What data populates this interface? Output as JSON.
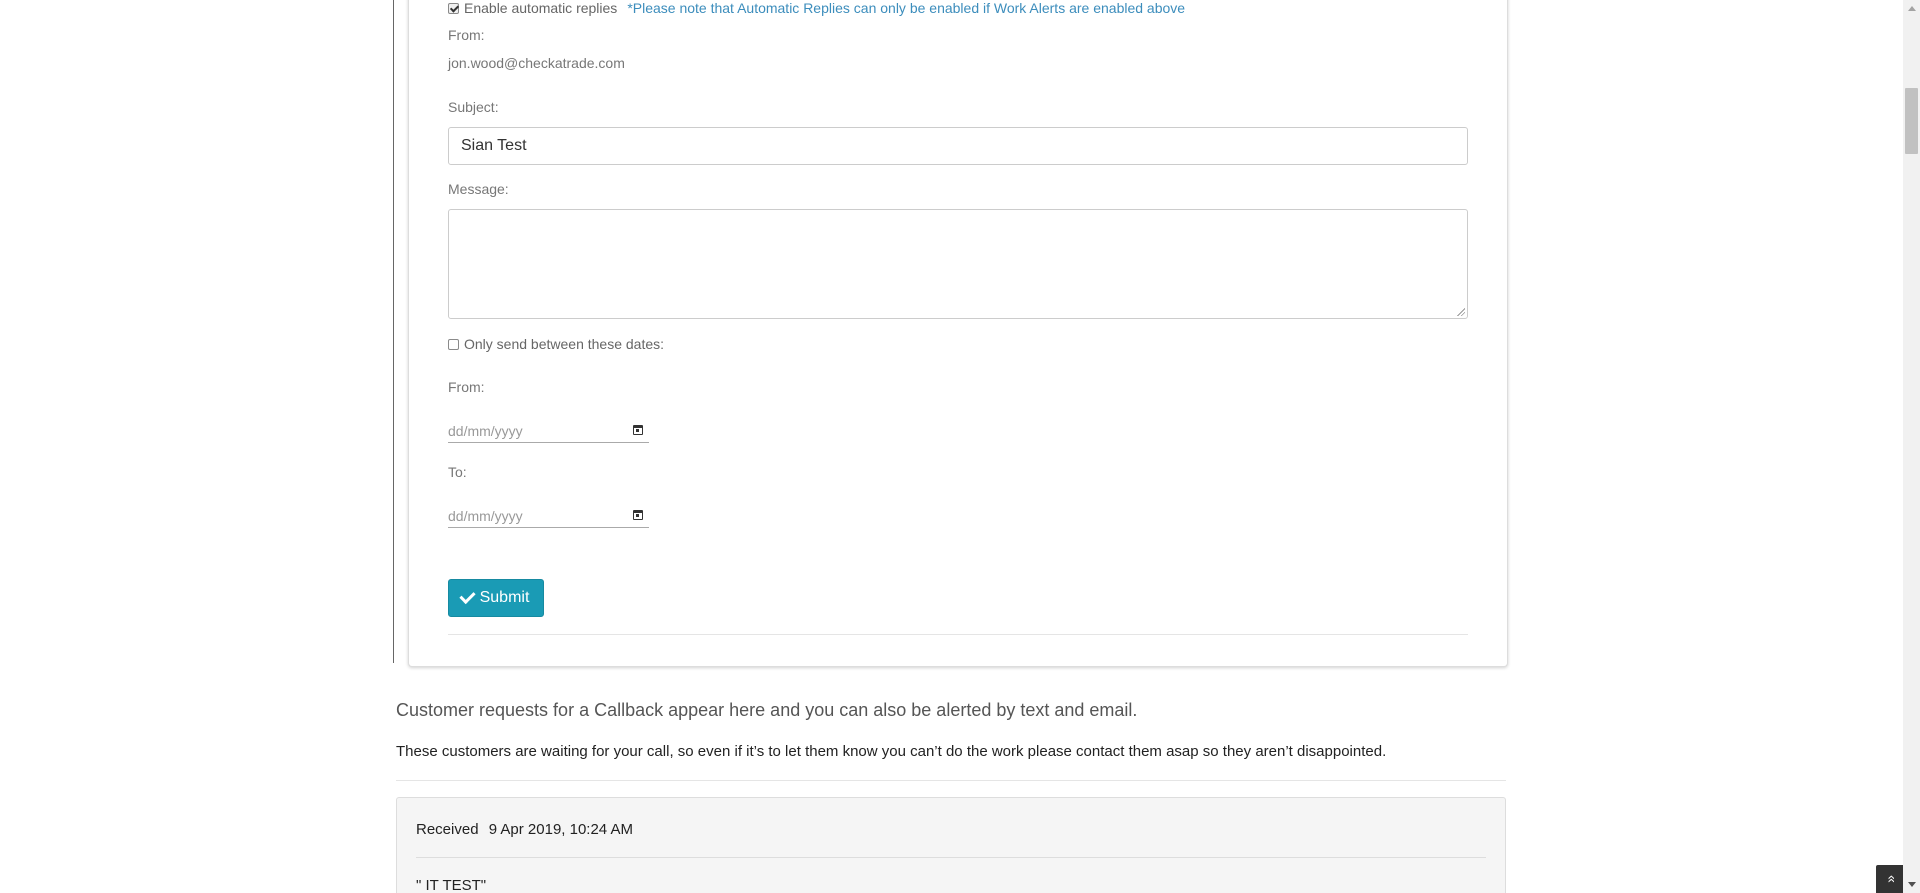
{
  "auto_reply": {
    "enable_label": "Enable automatic replies",
    "enable_checked": true,
    "note": "*Please note that Automatic Replies can only be enabled if Work Alerts are enabled above",
    "from_label": "From:",
    "from_value": "jon.wood@checkatrade.com",
    "subject_label": "Subject:",
    "subject_value": "Sian Test",
    "message_label": "Message:",
    "message_value": "",
    "date_range_label": "Only send between these dates:",
    "date_range_checked": false,
    "date_from_label": "From:",
    "date_from_placeholder": "dd/mm/yyyy",
    "date_to_label": "To:",
    "date_to_placeholder": "dd/mm/yyyy",
    "submit_label": "Submit"
  },
  "callbacks": {
    "lead": "Customer requests for a Callback appear here and you can also be alerted by text and email.",
    "body": "These customers are waiting for your call, so even if it’s to let them know you can’t do the work please contact them asap so they aren’t disappointed.",
    "received_label": "Received",
    "received_date": "9 Apr 2019, 10:24 AM",
    "first_quote": "\" IT TEST\""
  },
  "icons": {
    "submit": "check-icon",
    "calendar": "calendar-icon",
    "back_to_top": "double-chevron-up-icon"
  },
  "colors": {
    "accent": "#1a9bb5",
    "note_text": "#3c8dbc"
  }
}
